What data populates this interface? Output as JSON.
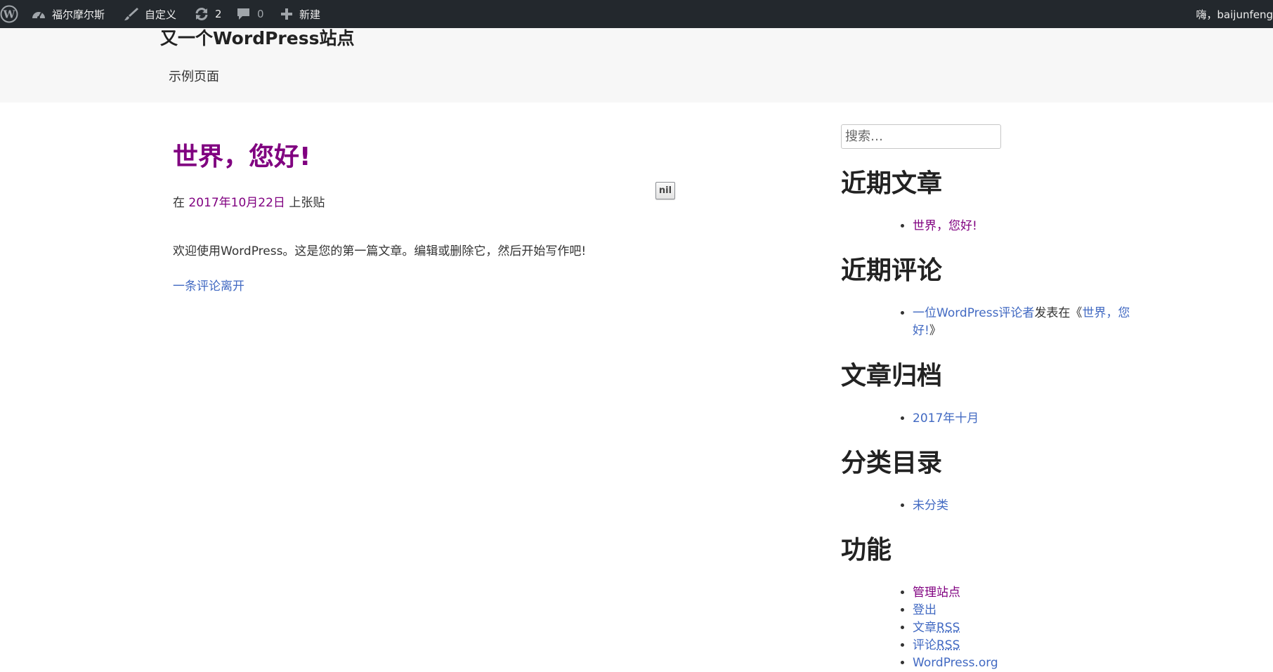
{
  "adminbar": {
    "site_name": "福尔摩尔斯",
    "customize": "自定义",
    "updates_count": "2",
    "comments_count": "0",
    "new": "新建",
    "greeting": "嗨，baijunfeng"
  },
  "header": {
    "site_title": "又一个WordPress站点",
    "nav_page": "示例页面"
  },
  "post": {
    "title": "世界，您好!",
    "meta_prefix": "在 ",
    "meta_date": "2017年10月22日",
    "meta_suffix": " 上张贴",
    "nil_label": "nil",
    "content": "欢迎使用WordPress。这是您的第一篇文章。编辑或删除它，然后开始写作吧!",
    "comments_link": "一条评论离开"
  },
  "sidebar": {
    "search_placeholder": "搜索…",
    "recent_posts": {
      "title": "近期文章",
      "items": [
        "世界，您好!"
      ]
    },
    "recent_comments": {
      "title": "近期评论",
      "author": "一位WordPress评论者",
      "middle": "发表在《",
      "post_part1": "世界，您",
      "post_part2": "好!",
      "close": "》"
    },
    "archives": {
      "title": "文章归档",
      "items": [
        "2017年十月"
      ]
    },
    "categories": {
      "title": "分类目录",
      "items": [
        "未分类"
      ]
    },
    "meta": {
      "title": "功能",
      "manage": "管理站点",
      "logout": "登出",
      "posts_prefix": "文章",
      "posts_rss": "RSS",
      "comments_prefix": "评论",
      "comments_rss": "RSS",
      "wordpress_org": "WordPress.org"
    }
  },
  "colors": {
    "adminbar_bg": "#23282d",
    "header_bg": "#f7f7f7",
    "visited_link": "#800080",
    "link": "#4169c2"
  }
}
